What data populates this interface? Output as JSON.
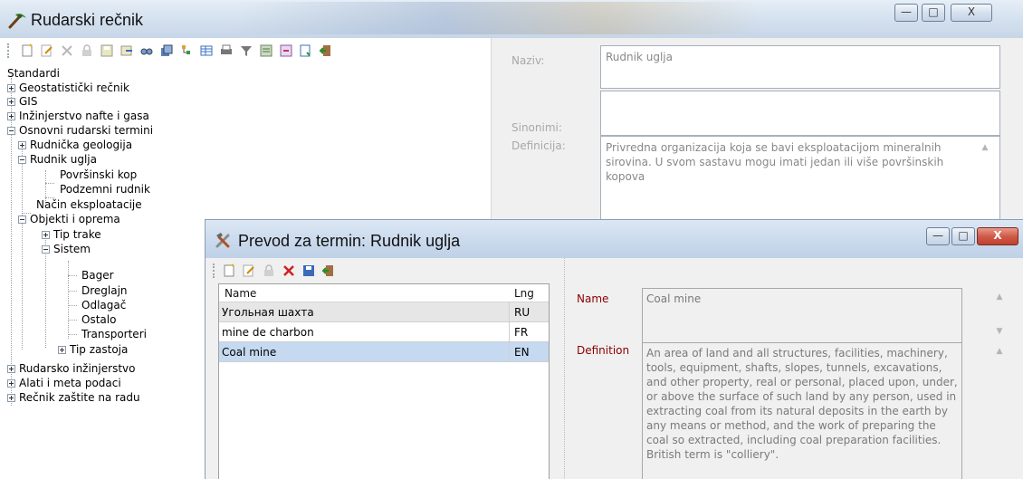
{
  "main_window": {
    "title": "Rudarski rečnik",
    "controls": {
      "minimize": "—",
      "maximize": "□",
      "close": "X"
    }
  },
  "toolbar": {
    "icons": [
      "new-icon",
      "edit-icon",
      "delete-icon",
      "lock-icon",
      "save-icon",
      "export-icon",
      "find-icon",
      "copy-icon",
      "tree-icon",
      "table-icon",
      "print-icon",
      "filter-icon",
      "settings-icon",
      "import-icon",
      "report-icon",
      "exit-icon"
    ]
  },
  "tree": {
    "root": "Standardi",
    "nodes": [
      {
        "label": "Geostatistički rečnik",
        "state": "collapsed"
      },
      {
        "label": "GIS",
        "state": "collapsed"
      },
      {
        "label": "Inžinjerstvo nafte i gasa",
        "state": "collapsed"
      },
      {
        "label": "Osnovni rudarski termini",
        "state": "expanded"
      },
      {
        "label": "Rudnička geologija",
        "state": "collapsed"
      },
      {
        "label": "Rudnik uglja",
        "state": "expanded"
      },
      {
        "label": "Površinski kop",
        "state": "leaf"
      },
      {
        "label": "Podzemni rudnik",
        "state": "leaf"
      },
      {
        "label": "Način eksploatacije",
        "state": "leaf"
      },
      {
        "label": "Objekti i oprema",
        "state": "expanded"
      },
      {
        "label": "Tip trake",
        "state": "collapsed"
      },
      {
        "label": "Sistem",
        "state": "expanded"
      },
      {
        "label": "Bager",
        "state": "leaf"
      },
      {
        "label": "Dreglajn",
        "state": "leaf"
      },
      {
        "label": "Odlagač",
        "state": "leaf"
      },
      {
        "label": "Ostalo",
        "state": "leaf"
      },
      {
        "label": "Transporteri",
        "state": "leaf"
      },
      {
        "label": "Tip zastoja",
        "state": "collapsed"
      },
      {
        "label": "Rudarsko inžinjerstvo",
        "state": "collapsed"
      },
      {
        "label": "Alati i meta podaci",
        "state": "collapsed"
      },
      {
        "label": "Rečnik zaštite na radu",
        "state": "collapsed"
      }
    ]
  },
  "detail": {
    "naziv_label": "Naziv:",
    "naziv_value": "Rudnik uglja",
    "sinonimi_label": "Sinonimi:",
    "sinonimi_value": "",
    "definicija_label": "Definicija:",
    "definicija_value": "Privredna organizacija koja se bavi eksploatacijom mineralnih sirovina. U svom sastavu mogu imati jedan ili više površinskih kopova"
  },
  "dialog": {
    "title": "Prevod za termin: Rudnik uglja",
    "controls": {
      "minimize": "—",
      "maximize": "□",
      "close": "X"
    },
    "toolbar_icons": [
      "new-icon",
      "edit-icon",
      "lock-icon",
      "delete-icon",
      "save-icon",
      "exit-icon"
    ],
    "grid": {
      "headers": [
        "Name",
        "Lng"
      ],
      "rows": [
        {
          "name": "Угольная шахта",
          "lng": "RU",
          "selected": false
        },
        {
          "name": "mine de charbon",
          "lng": "FR",
          "selected": false
        },
        {
          "name": "Coal mine",
          "lng": "EN",
          "selected": true
        }
      ]
    },
    "name_label": "Name",
    "name_value": "Coal mine",
    "definition_label": "Definition",
    "definition_value": "An area of land and all structures, facilities, machinery, tools, equipment, shafts, slopes, tunnels, excavations, and other property, real or personal, placed upon, under, or above the surface of such land by any person, used in extracting coal from its natural deposits in the earth by any means or method, and the work of preparing the coal so extracted, including coal preparation facilities. British term is \"colliery\"."
  },
  "colors": {
    "selected_row": "#c5d9f1",
    "dialog_label": "#8b0000",
    "close_button": "#c9463d"
  }
}
